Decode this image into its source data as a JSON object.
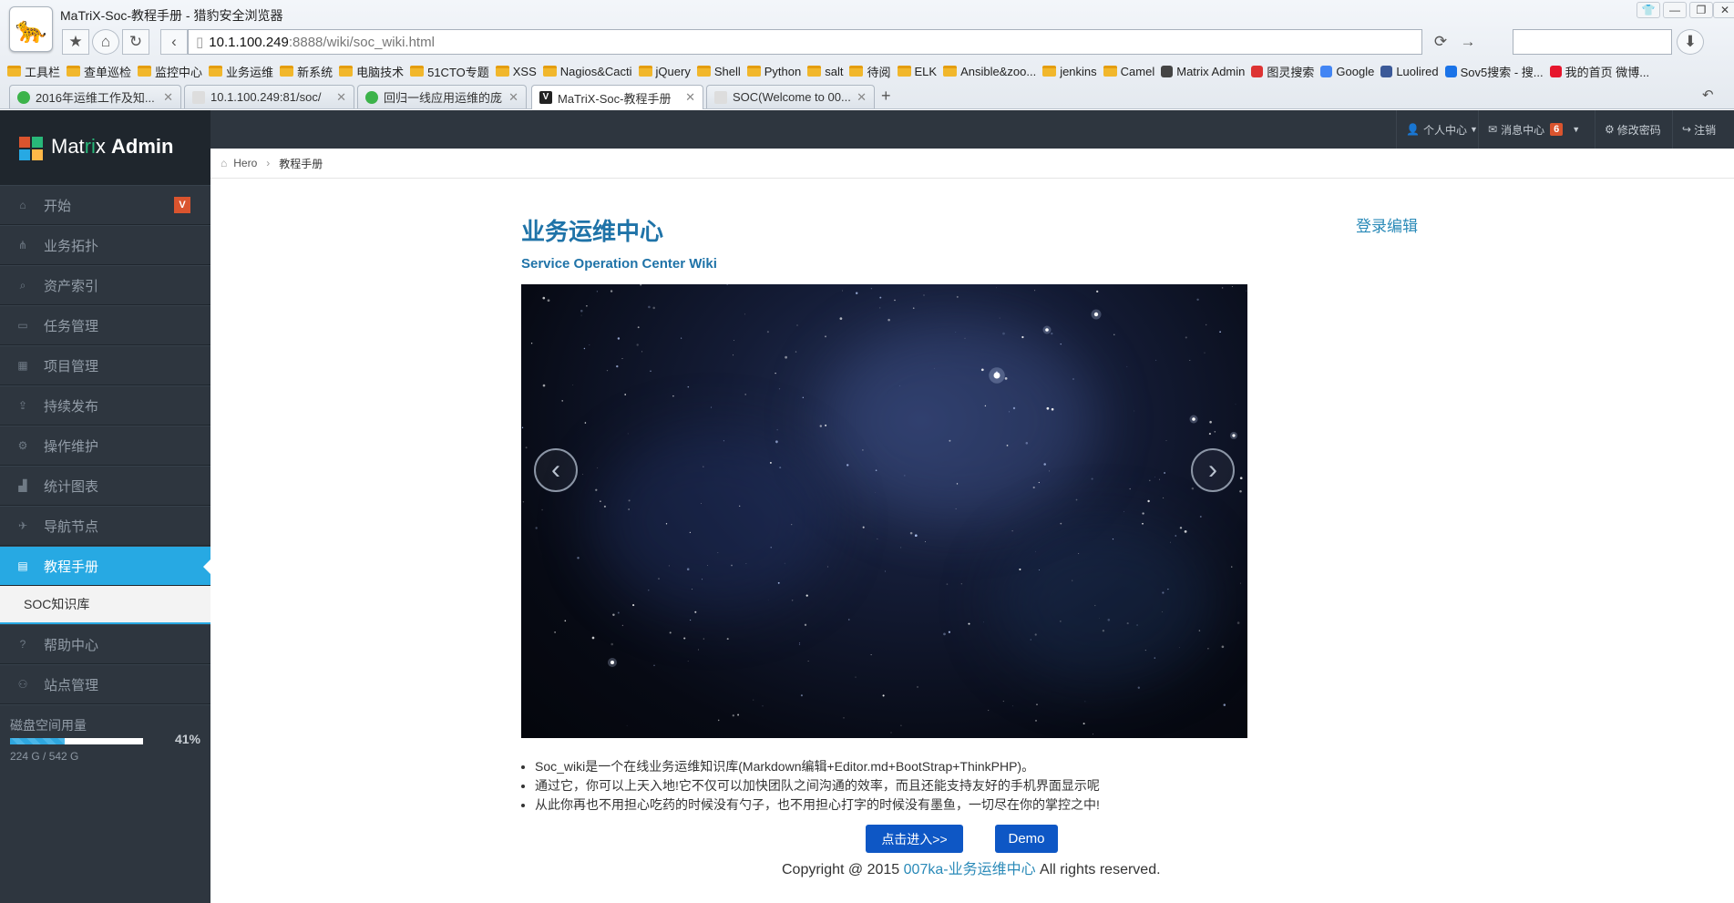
{
  "browser": {
    "window_title": "MaTriX-Soc-教程手册 - 猎豹安全浏览器",
    "address": {
      "host": "10.1.100.249",
      "path": ":8888/wiki/soc_wiki.html"
    },
    "bookmarks": [
      {
        "label": "工具栏",
        "icon": "folder"
      },
      {
        "label": "查单巡检",
        "icon": "folder"
      },
      {
        "label": "监控中心",
        "icon": "folder"
      },
      {
        "label": "业务运维",
        "icon": "folder"
      },
      {
        "label": "新系统",
        "icon": "folder"
      },
      {
        "label": "电脑技术",
        "icon": "folder"
      },
      {
        "label": "51CTO专题",
        "icon": "folder"
      },
      {
        "label": "XSS",
        "icon": "folder"
      },
      {
        "label": "Nagios&Cacti",
        "icon": "folder"
      },
      {
        "label": "jQuery",
        "icon": "folder"
      },
      {
        "label": "Shell",
        "icon": "folder"
      },
      {
        "label": "Python",
        "icon": "folder"
      },
      {
        "label": "salt",
        "icon": "folder"
      },
      {
        "label": "待阅",
        "icon": "folder"
      },
      {
        "label": "ELK",
        "icon": "folder"
      },
      {
        "label": "Ansible&zoo...",
        "icon": "folder"
      },
      {
        "label": "jenkins",
        "icon": "folder"
      },
      {
        "label": "Camel",
        "icon": "folder"
      },
      {
        "label": "Matrix Admin",
        "icon": "site"
      },
      {
        "label": "图灵搜索",
        "icon": "site"
      },
      {
        "label": "Google",
        "icon": "site"
      },
      {
        "label": "Luolired",
        "icon": "site"
      },
      {
        "label": "Sov5搜索 - 搜...",
        "icon": "site"
      },
      {
        "label": "我的首页 微博...",
        "icon": "site"
      }
    ],
    "tabs": [
      {
        "label": "2016年运维工作及知...",
        "icon_color": "#3cb34a"
      },
      {
        "label": "10.1.100.249:81/soc/",
        "icon_color": "#cccccc"
      },
      {
        "label": "回归一线应用运维的庞...",
        "icon_color": "#3cb34a"
      },
      {
        "label": "MaTriX-Soc-教程手册",
        "icon_color": "#222222",
        "active": true
      },
      {
        "label": "SOC(Welcome to 00...",
        "icon_color": "#cccccc"
      }
    ]
  },
  "app": {
    "logo": {
      "prefix": "Mat",
      "accent": "ri",
      "mid": "x ",
      "bold": "Admin"
    },
    "header_buttons": {
      "profile": "个人中心",
      "messages": "消息中心",
      "messages_count": "6",
      "change_password": "修改密码",
      "logout": "注销"
    },
    "sidebar": {
      "items": [
        {
          "label": "开始",
          "icon": "home-icon",
          "badge": "V"
        },
        {
          "label": "业务拓扑",
          "icon": "sitemap-icon"
        },
        {
          "label": "资产索引",
          "icon": "search-icon"
        },
        {
          "label": "任务管理",
          "icon": "inbox-icon"
        },
        {
          "label": "项目管理",
          "icon": "calendar-icon"
        },
        {
          "label": "持续发布",
          "icon": "upload-icon"
        },
        {
          "label": "操作维护",
          "icon": "cogs-icon"
        },
        {
          "label": "统计图表",
          "icon": "signal-icon"
        },
        {
          "label": "导航节点",
          "icon": "plane-icon"
        },
        {
          "label": "教程手册",
          "icon": "book-icon",
          "active": true
        }
      ],
      "submenu": {
        "label": "SOC知识库"
      },
      "items_after": [
        {
          "label": "帮助中心",
          "icon": "question-icon"
        },
        {
          "label": "站点管理",
          "icon": "group-icon"
        }
      ],
      "disk": {
        "label": "磁盘空间用量",
        "used": "224 G / 542 G",
        "percent_text": "41%",
        "percent": 0.41
      }
    },
    "breadcrumb": {
      "home": "Hero",
      "current": "教程手册"
    },
    "main": {
      "title": "业务运维中心",
      "subtitle": "Service Operation Center Wiki",
      "login_edit": "登录编辑",
      "description": [
        "Soc_wiki是一个在线业务运维知识库(Markdown编辑+Editor.md+BootStrap+ThinkPHP)。",
        "通过它，你可以上天入地!它不仅可以加快团队之间沟通的效率，而且还能支持友好的手机界面显示呢",
        "从此你再也不用担心吃药的时候没有勺子，也不用担心打字的时候没有墨鱼，一切尽在你的掌控之中!"
      ],
      "enter_button": "点击进入>>",
      "demo_button": "Demo",
      "copyright": {
        "prefix": "Copyright @ 2015 ",
        "link": "007ka-业务运维中心",
        "suffix": " All rights reserved."
      }
    },
    "colors": {
      "sidebar_bg": "#2e363f",
      "active": "#27a9e3",
      "accent_green": "#28b779",
      "badge_red": "#da542e",
      "button_blue": "#0e57c5"
    }
  }
}
